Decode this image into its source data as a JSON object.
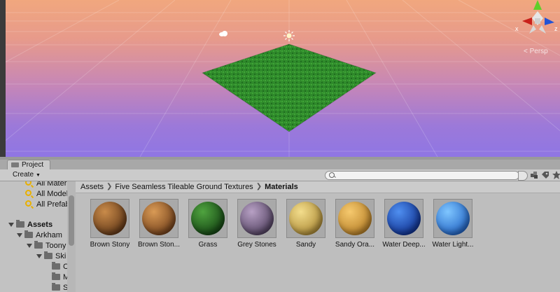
{
  "scene": {
    "projection_label": "< Persp",
    "gizmo_axes": {
      "x": "x",
      "z": "z"
    },
    "colors": {
      "sky_top": "#f1a77e",
      "sky_bottom": "#8f76e4",
      "ground_plane": "#2d8a2a"
    },
    "icons": [
      "cloud-icon",
      "sun-icon",
      "orientation-gizmo-icon"
    ]
  },
  "project_panel": {
    "tab_label": "Project",
    "create_label": "Create",
    "search_placeholder": "",
    "tree": [
      {
        "label": "All Materials",
        "icon": "search-icon",
        "bold": false
      },
      {
        "label": "All Models",
        "icon": "search-icon",
        "bold": false
      },
      {
        "label": "All Prefabs",
        "icon": "search-icon",
        "bold": false
      },
      {
        "label": "Assets",
        "icon": "folder-icon",
        "bold": true
      },
      {
        "label": "Arkham",
        "icon": "folder-icon",
        "bold": false
      },
      {
        "label": "Toony",
        "icon": "folder-icon",
        "bold": false
      },
      {
        "label": "Ski",
        "icon": "folder-icon",
        "bold": false
      },
      {
        "label": "C",
        "icon": "folder-icon",
        "bold": false
      },
      {
        "label": "M",
        "icon": "folder-icon",
        "bold": false
      },
      {
        "label": "S",
        "icon": "folder-icon",
        "bold": false
      }
    ],
    "breadcrumb": {
      "root": "Assets",
      "folder": "Five Seamless Tileable Ground Textures",
      "current": "Materials"
    },
    "assets": [
      {
        "label": "Brown Stony",
        "color_light": "#c98b4a",
        "color_dark": "#5a3214"
      },
      {
        "label": "Brown Ston...",
        "color_light": "#d99a55",
        "color_dark": "#6b3a17"
      },
      {
        "label": "Grass",
        "color_light": "#4fa33f",
        "color_dark": "#103d10"
      },
      {
        "label": "Grey Stones",
        "color_light": "#b7a0c4",
        "color_dark": "#4b3b5a"
      },
      {
        "label": "Sandy",
        "color_light": "#f3dd8c",
        "color_dark": "#a88530"
      },
      {
        "label": "Sandy Ora...",
        "color_light": "#f6c96e",
        "color_dark": "#b27a22"
      },
      {
        "label": "Water Deep...",
        "color_light": "#4f8ff0",
        "color_dark": "#0b2a8a"
      },
      {
        "label": "Water Light...",
        "color_light": "#7fc6ff",
        "color_dark": "#1a5cc0"
      }
    ]
  }
}
